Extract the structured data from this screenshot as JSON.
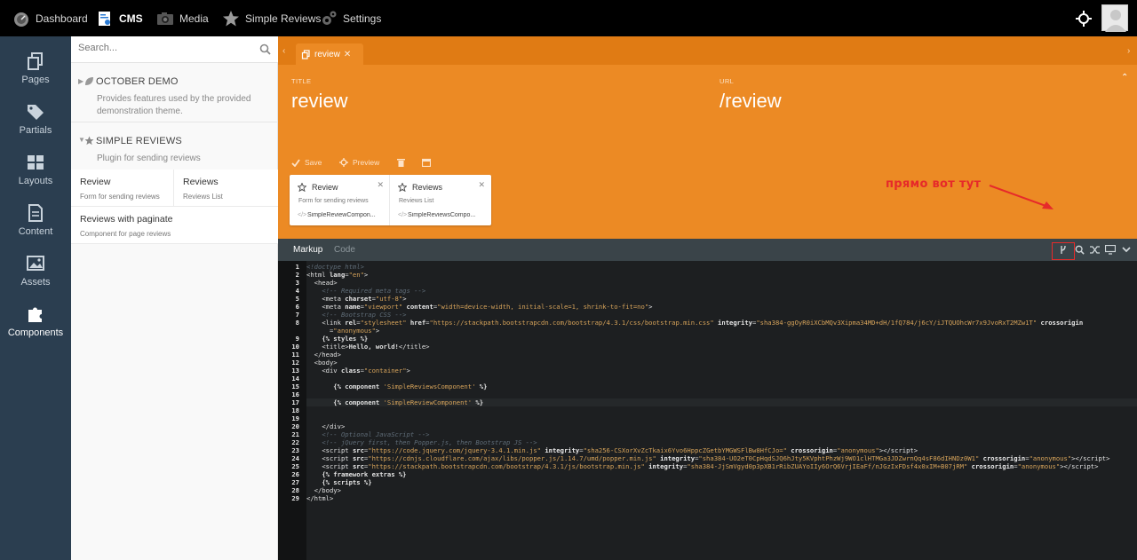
{
  "topbar": {
    "items": [
      {
        "label": "Dashboard",
        "icon": "speedometer-icon"
      },
      {
        "label": "CMS",
        "icon": "cms-icon"
      },
      {
        "label": "Media",
        "icon": "camera-icon"
      },
      {
        "label": "Simple Reviews",
        "icon": "star-icon"
      },
      {
        "label": "Settings",
        "icon": "gears-icon"
      }
    ]
  },
  "sidenav": {
    "items": [
      {
        "label": "Pages"
      },
      {
        "label": "Partials"
      },
      {
        "label": "Layouts"
      },
      {
        "label": "Content"
      },
      {
        "label": "Assets"
      },
      {
        "label": "Components"
      }
    ]
  },
  "panel": {
    "search_placeholder": "Search...",
    "plugins": [
      {
        "title": "OCTOBER DEMO",
        "desc": "Provides features used by the provided demonstration theme."
      },
      {
        "title": "SIMPLE REVIEWS",
        "desc": "Plugin for sending reviews"
      }
    ],
    "components": [
      {
        "title": "Review",
        "desc": "Form for sending reviews"
      },
      {
        "title": "Reviews",
        "desc": "Reviews List"
      },
      {
        "title": "Reviews with paginate",
        "desc": "Component for page reviews"
      }
    ]
  },
  "editor": {
    "tab_label": "review",
    "title_label": "TITLE",
    "title_value": "review",
    "url_label": "URL",
    "url_value": "/review",
    "tools": {
      "save": "Save",
      "preview": "Preview"
    },
    "cards": [
      {
        "name": "Review",
        "desc": "Form for sending reviews",
        "cls": "SimpleReviewCompon..."
      },
      {
        "name": "Reviews",
        "desc": "Reviews List",
        "cls": "SimpleReviewsCompo..."
      }
    ],
    "code_tabs": {
      "markup": "Markup",
      "code": "Code"
    }
  },
  "annotation": "прямо вот тут",
  "colors": {
    "orange": "#ec8a24",
    "orange_dark": "#e07b14",
    "nav": "#2b3e50",
    "annotation": "#e62a2a"
  }
}
